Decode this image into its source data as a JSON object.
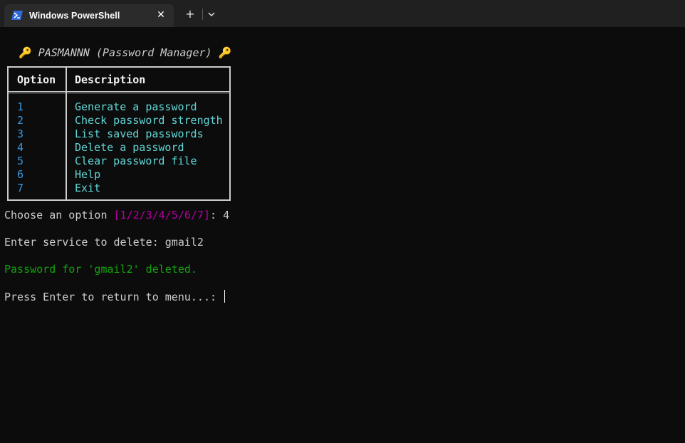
{
  "window": {
    "tab_title": "Windows PowerShell",
    "close_glyph": "✕",
    "new_tab_glyph": "+"
  },
  "colors": {
    "background": "#0c0c0c",
    "text": "#cccccc",
    "option_number": "#3a96dd",
    "option_description": "#61d6d6",
    "choices": "#b4009e",
    "success": "#13a10e"
  },
  "terminal": {
    "banner_icon": "🔑",
    "banner_title": "PASMANNN (Password Manager)",
    "table": {
      "headers": {
        "option": "Option",
        "description": "Description"
      },
      "rows": [
        {
          "option": "1",
          "description": "Generate a password"
        },
        {
          "option": "2",
          "description": "Check password strength"
        },
        {
          "option": "3",
          "description": "List saved passwords"
        },
        {
          "option": "4",
          "description": "Delete a password"
        },
        {
          "option": "5",
          "description": "Clear password file"
        },
        {
          "option": "6",
          "description": "Help"
        },
        {
          "option": "7",
          "description": "Exit"
        }
      ]
    },
    "prompt_choose": "Choose an option ",
    "prompt_choices": "[1/2/3/4/5/6/7]",
    "prompt_choose_suffix": ": ",
    "prompt_choose_value": "4",
    "prompt_service": "Enter service to delete: ",
    "prompt_service_value": "gmail2",
    "result_message": "Password for 'gmail2' deleted.",
    "prompt_return": "Press Enter to return to menu...: "
  }
}
